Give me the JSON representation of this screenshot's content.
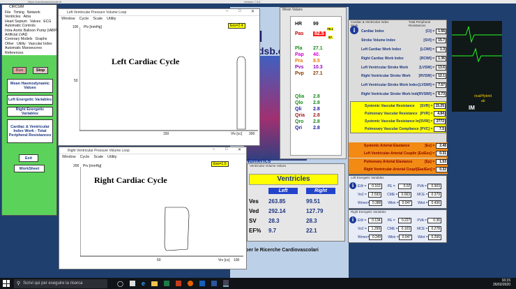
{
  "browser": {
    "url": "https://cardiovascularsite.it/",
    "title": "Version 7.3.0",
    "app": "CIRCSIM"
  },
  "left_menu": {
    "items": [
      "File",
      "Timing",
      "Network",
      "Ventricles",
      "Atria",
      "Heart Septum",
      "Valves",
      "ECG",
      "Automatic Controls",
      "Intra-Aortic Balloon Pump (IABP)",
      "Artificial LVAD",
      "Coronary Models",
      "Graphs",
      "Other",
      "Utility",
      "Vascular Index",
      "Automatic Manoeuvres",
      "References"
    ],
    "run_label": "Run",
    "stop_label": "Stop",
    "buttons": [
      "Mean Haemodynamic Values",
      "Left Energetic Variables",
      "Right Energetic Variables",
      "Cardiac & Ventricular Index Work - Total Peripheral Resistances"
    ],
    "exit_label": "Exit",
    "worksheet_label": "WorkSheet"
  },
  "lv_window": {
    "title": "Left Ventricular Pressure Volume Loop",
    "menu": [
      "Window",
      "Cycle",
      "Scale",
      "Utility"
    ],
    "ees": "Ees=2.4",
    "plot_title": "Left Cardiac Cycle",
    "y_label": "Plv [mmHg]",
    "y_top": "100",
    "y_mid": "50",
    "x_mid": "150",
    "x_right": "300",
    "x_label": "Vlv [cc]"
  },
  "rv_window": {
    "title": "Right Ventricular Pressure Volume Loop",
    "menu": [
      "Window",
      "Cycle",
      "Scale",
      "Utility"
    ],
    "ees": "Ees=1.5",
    "plot_title": "Right Cardiac Cycle",
    "y_label": "Prv [mmHg]",
    "y_top": "200",
    "x_mid": "50",
    "x_right": "100",
    "x_label": "Vrv [cc]"
  },
  "mean_values": {
    "title": "Mean Values",
    "hr_label": "HR",
    "hr": "99",
    "pas_label": "Pas",
    "pas": "82.5",
    "pas_hi": "78.1",
    "pas_lo": "57.",
    "rows": [
      {
        "label": "Pla",
        "value": "27.1",
        "color": "#1a8a1a"
      },
      {
        "label": "Pap",
        "value": "40.",
        "color": "#d400d4"
      },
      {
        "label": "Pra",
        "value": "8.5",
        "color": "#f07800"
      },
      {
        "label": "Pvs",
        "value": "10.3",
        "color": "#9a00c0"
      },
      {
        "label": "Pvp",
        "value": "27.1",
        "color": "#8a3a00"
      }
    ],
    "q_rows": [
      {
        "label": "Qlia",
        "value": "2.8",
        "color": "#1a8a1a"
      },
      {
        "label": "Qlo",
        "value": "2.8",
        "color": "#1a8a1a"
      },
      {
        "label": "Qli",
        "value": "2.8",
        "color": "#1a1aa0"
      },
      {
        "label": "Qria",
        "value": "2.8",
        "color": "#a01a1a"
      },
      {
        "label": "Qro",
        "value": "2.8",
        "color": "#1a8a1a"
      },
      {
        "label": "Qri",
        "value": "2.8",
        "color": "#1a1aa0"
      }
    ]
  },
  "cardiac_work": {
    "title": "Cardiac & Ventricular Index Work",
    "title2": "Total Peripheral Resistances",
    "rows": [
      {
        "label": "Cardiac Index",
        "abbr": "[CI] =",
        "value": "1.56"
      },
      {
        "label": "Stroke Volume Index",
        "abbr": "[SVI] =",
        "value": "15.7"
      },
      {
        "label": "Left Cardiac Work Index",
        "abbr": "[LCWI] =",
        "value": "1.3"
      },
      {
        "label": "Right Cardiac Work Index",
        "abbr": "[RCWI] =",
        "value": "1.36"
      },
      {
        "label": "Left Ventricular Stroke Work",
        "abbr": "[LVSW] =",
        "value": "13.6"
      },
      {
        "label": "Right Ventricular Stroke Work",
        "abbr": "[RVSW] =",
        "value": "12.1"
      },
      {
        "label": "Left Ventricular Stroke Work Index",
        "abbr": "[LVSWI] =",
        "value": "7.57"
      },
      {
        "label": "Right Ventricular Stroke Work Index",
        "abbr": "[RVSWI] =",
        "value": "6.73"
      }
    ],
    "resistances": [
      {
        "label": "Systemic Vascular Resistance",
        "abbr": "[SVR] =",
        "value": "15.25"
      },
      {
        "label": "Pulmonary Vascular Resistance",
        "abbr": "[PVR] =",
        "value": "4.84"
      },
      {
        "label": "Systemic Vascular Resistance Index",
        "abbr": "[SVRI] =",
        "value": "2772"
      },
      {
        "label": "Pulmonary Vascular Compliance",
        "abbr": "[PVC] =",
        "value": "7.5"
      }
    ],
    "arterial": [
      {
        "label": "Systemic Arterial Elastance",
        "abbr": "[Es] =",
        "value": "2.48"
      },
      {
        "label": "Left Ventricular-Arterial Coupling",
        "abbr": "[Es/Ees] =",
        "value": "0.31"
      }
    ],
    "pulmonary": [
      {
        "label": "Pulmonary Arterial Elastance",
        "abbr": "[Ep] =",
        "value": "1.53"
      },
      {
        "label": "Right Ventricular-Arterial Coupling",
        "abbr": "[Eas/Ees] =",
        "value": "0.32"
      }
    ]
  },
  "left_energetic": {
    "title": "Left Energetic Variables",
    "rows": [
      [
        {
          "l": "EW =",
          "v": "0.163"
        },
        {
          "l": "PE =",
          "v": "0.02"
        },
        {
          "l": "PVA =",
          "v": "0.903"
        }
      ],
      [
        {
          "l": "Vo2 =",
          "v": "2.593"
        },
        {
          "l": "CME =",
          "v": "0.063"
        },
        {
          "l": "MCE =",
          "v": "0.379"
        }
      ],
      [
        {
          "l": "Wmec=",
          "v": "0.388"
        },
        {
          "l": "Wkin =",
          "v": "0.047"
        },
        {
          "l": "Wtot =",
          "v": "0.436"
        }
      ]
    ]
  },
  "right_energetic": {
    "title": "Right Energetic Variables",
    "rows": [
      [
        {
          "l": "EW =",
          "v": "0.134"
        },
        {
          "l": "PE =",
          "v": "0.227"
        },
        {
          "l": "PVA =",
          "v": "0.36"
        }
      ],
      [
        {
          "l": "Vo2 =",
          "v": "1.299"
        },
        {
          "l": "CME =",
          "v": "0.103"
        },
        {
          "l": "MCE =",
          "v": "0.278"
        }
      ],
      [
        {
          "l": "Wmec=",
          "v": "0.249"
        },
        {
          "l": "Wkin =",
          "v": "0.047"
        },
        {
          "l": "Wtot =",
          "v": "0.296"
        }
      ]
    ]
  },
  "ventricular_volume": {
    "title": "Ventricular Volume Values",
    "header": "Ventricles",
    "left": "Left",
    "right": "Right",
    "rows": [
      {
        "label": "Ves",
        "left": "263.85",
        "right": "99.51"
      },
      {
        "label": "Ved",
        "left": "292.14",
        "right": "127.79"
      },
      {
        "label": "SV",
        "left": "28.3",
        "right": "28.3"
      },
      {
        "label": "EF%",
        "left": "9.7",
        "right": "22.1"
      }
    ]
  },
  "background": {
    "site_fragment1": "ical",
    "site_fragment2": "dsb.c",
    "numerics": "Numerics",
    "footer": "ionale per le Ricerche Cardiovascolari",
    "right_text1": "rical/Hybrid",
    "right_text2": "ab",
    "right_text3": "IM"
  },
  "taskbar": {
    "search_placeholder": "Scrivi qui per eseguire la ricerca",
    "time": "16:15",
    "date": "26/02/2020"
  }
}
